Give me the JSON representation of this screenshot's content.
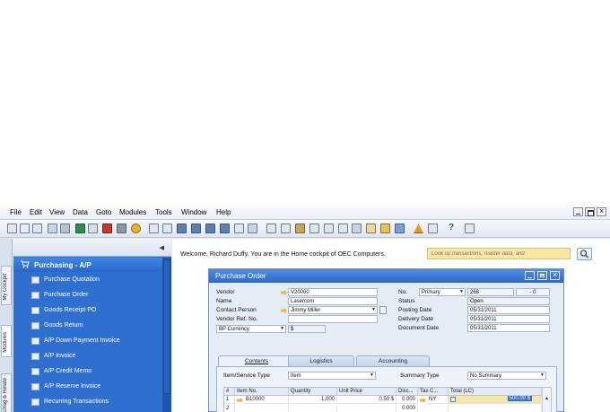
{
  "menu": [
    "File",
    "Edit",
    "View",
    "Data",
    "Goto",
    "Modules",
    "Tools",
    "Window",
    "Help"
  ],
  "left_tabs": [
    "My Cockpit",
    "Modules",
    "Drag & Relate"
  ],
  "modules": {
    "section": "Purchasing - A/P",
    "items": [
      "Purchase Quotation",
      "Purchase Order",
      "Goods Receipt PO",
      "Goods Return",
      "A/P Down Payment Invoice",
      "A/P Invoice",
      "A/P Credit Memo",
      "A/P Reserve Invoice",
      "Recurring Transactions"
    ]
  },
  "cockpit": {
    "welcome": "Welcome, Richard Duffy.  You are in the Home cockpit of OEC Computers.",
    "search_placeholder": "Look up transactions, master data, and"
  },
  "purchase_order": {
    "title": "Purchase Order",
    "vendor_label": "Vendor",
    "vendor_value": "V20000",
    "name_label": "Name",
    "name_value": "Lasercom",
    "contact_label": "Contact Person",
    "contact_value": "Jimmy Miller",
    "ref_label": "Vendor Ref. No.",
    "ref_value": "",
    "currency_value": "BP Currency",
    "currency_symbol": "$",
    "no_label": "No.",
    "series_value": "Primary",
    "doc_number": "268",
    "doc_extra": "0",
    "status_label": "Status",
    "status_value": "Open",
    "posting_label": "Posting Date",
    "posting_value": "05/31/2011",
    "delivery_label": "Delivery Date",
    "delivery_value": "05/31/2011",
    "docdate_label": "Document Date",
    "docdate_value": "05/31/2011",
    "tabs": [
      "Contents",
      "Logistics",
      "Accounting"
    ],
    "item_type_label": "Item/Service Type",
    "item_type_value": "Item",
    "summary_label": "Summary Type",
    "summary_value": "No Summary",
    "columns": [
      "#",
      "Item No.",
      "Quantity",
      "Unit Price",
      "Disc...",
      "Tax C...",
      "Total (LC)"
    ],
    "rows": [
      {
        "num": "1",
        "item": "B10000",
        "qty": "1,000",
        "price": "0.50 $",
        "disc": "0.000",
        "tax": "NY",
        "total": "500.00 $"
      },
      {
        "num": "2",
        "item": "",
        "qty": "",
        "price": "",
        "disc": "0.000",
        "tax": "",
        "total": ""
      }
    ]
  },
  "colors": {
    "panel_blue": "#2f6fd0",
    "title_blue": "#2f67c4",
    "search_bg": "#f8e7a4",
    "link_arrow": "#f2b531"
  }
}
